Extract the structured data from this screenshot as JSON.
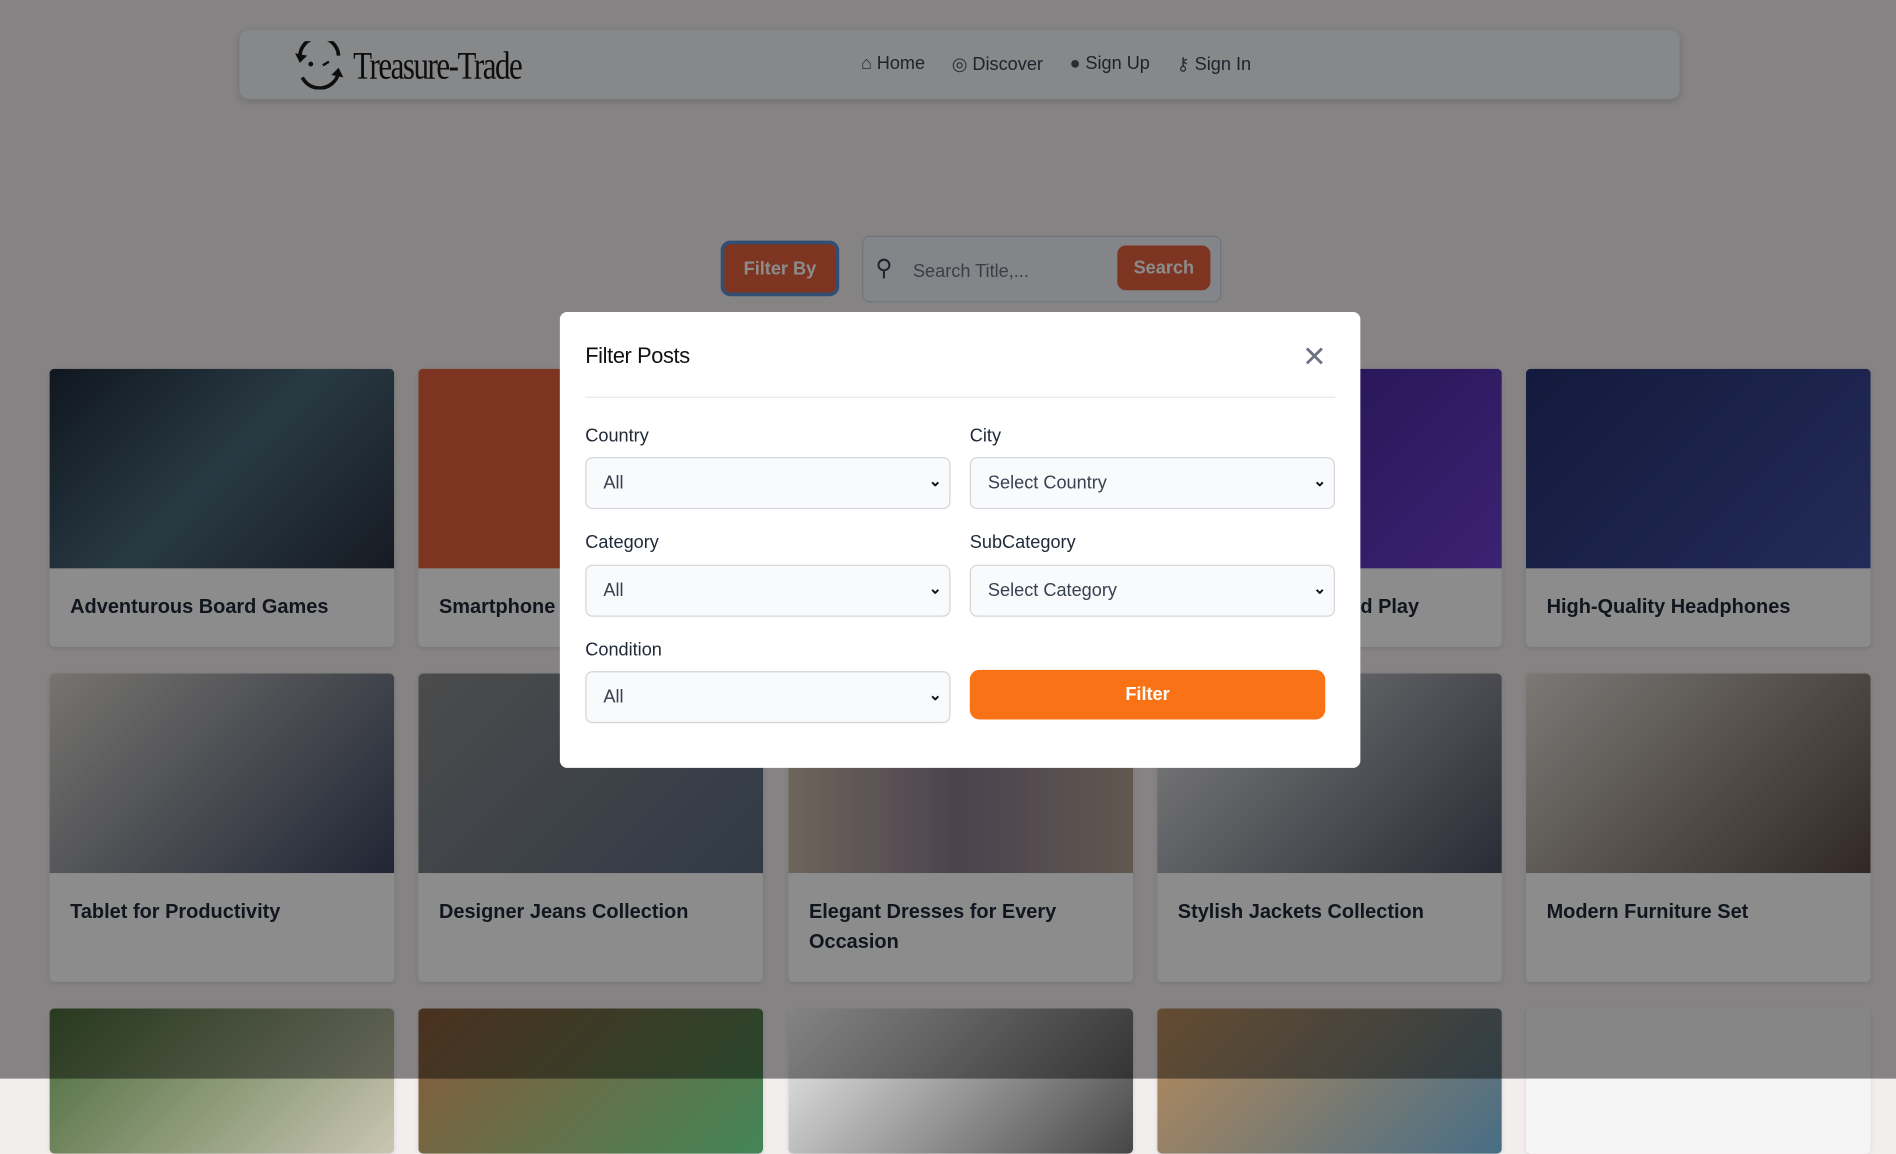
{
  "header": {
    "brand": "Treasure-Trade",
    "links": [
      {
        "label": "Home",
        "icon": "home-icon"
      },
      {
        "label": "Discover",
        "icon": "compass-icon"
      },
      {
        "label": "Sign Up",
        "icon": "user-circle-icon"
      },
      {
        "label": "Sign In",
        "icon": "key-icon"
      }
    ]
  },
  "toolbar": {
    "filter_by": "Filter By",
    "search_placeholder": "Search Title,...",
    "search_label": "Search"
  },
  "cards": [
    {
      "title": "Adventurous Board Games"
    },
    {
      "title": "Smartphone"
    },
    {
      "title": ""
    },
    {
      "title": "d Play"
    },
    {
      "title": "High-Quality Headphones"
    },
    {
      "title": "Tablet for Productivity"
    },
    {
      "title": "Designer Jeans Collection"
    },
    {
      "title": "Elegant Dresses for Every Occasion"
    },
    {
      "title": "Stylish Jackets Collection"
    },
    {
      "title": "Modern Furniture Set"
    },
    {
      "title": ""
    },
    {
      "title": ""
    },
    {
      "title": ""
    },
    {
      "title": ""
    },
    {
      "title": ""
    }
  ],
  "modal": {
    "title": "Filter Posts",
    "fields": [
      {
        "label": "Country",
        "value": "All"
      },
      {
        "label": "City",
        "value": "Select Country"
      },
      {
        "label": "Category",
        "value": "All"
      },
      {
        "label": "SubCategory",
        "value": "Select Category"
      },
      {
        "label": "Condition",
        "value": "All"
      }
    ],
    "submit": "Filter"
  },
  "colors": {
    "accent": "#f97316",
    "button": "#e4613f"
  }
}
